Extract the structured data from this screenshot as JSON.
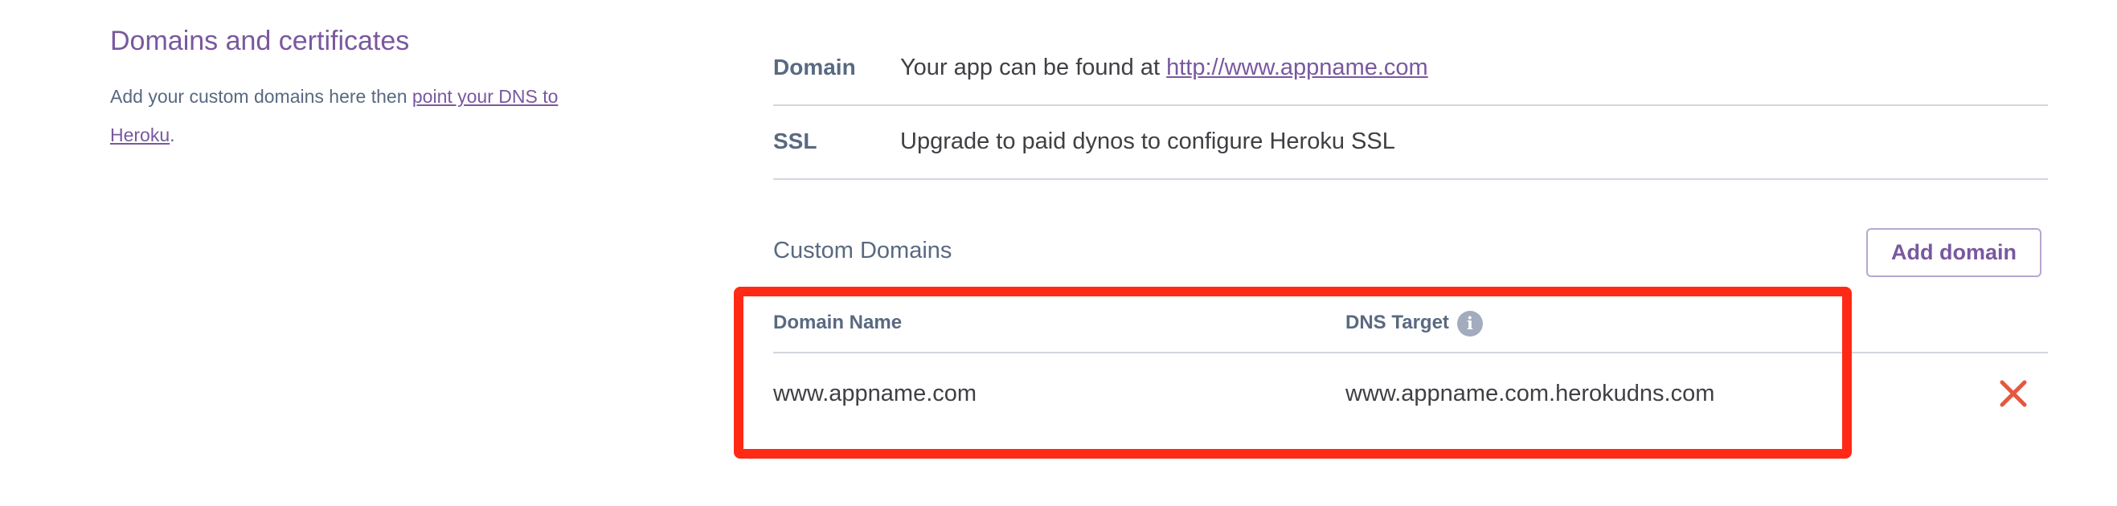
{
  "left_panel": {
    "title": "Domains and certificates",
    "desc_prefix": "Add your custom domains here then ",
    "desc_link": "point your DNS to Heroku",
    "desc_suffix": "."
  },
  "info": {
    "domain": {
      "label": "Domain",
      "text_prefix": "Your app can be found at ",
      "link": "http://www.appname.com"
    },
    "ssl": {
      "label": "SSL",
      "text": "Upgrade to paid dynos to configure Heroku SSL"
    }
  },
  "custom_domains": {
    "title": "Custom Domains",
    "add_button": "Add domain",
    "columns": {
      "domain_name": "Domain Name",
      "dns_target": "DNS Target"
    },
    "rows": [
      {
        "domain_name": "www.appname.com",
        "dns_target": "www.appname.com.herokudns.com"
      }
    ]
  },
  "icons": {
    "info": "info-icon",
    "remove": "close-x-icon"
  },
  "colors": {
    "accent": "#79589f",
    "label": "#596981",
    "text": "#3f3f44",
    "divider": "#d2d6de",
    "remove": "#e5573f",
    "highlight": "#ff2a16"
  }
}
